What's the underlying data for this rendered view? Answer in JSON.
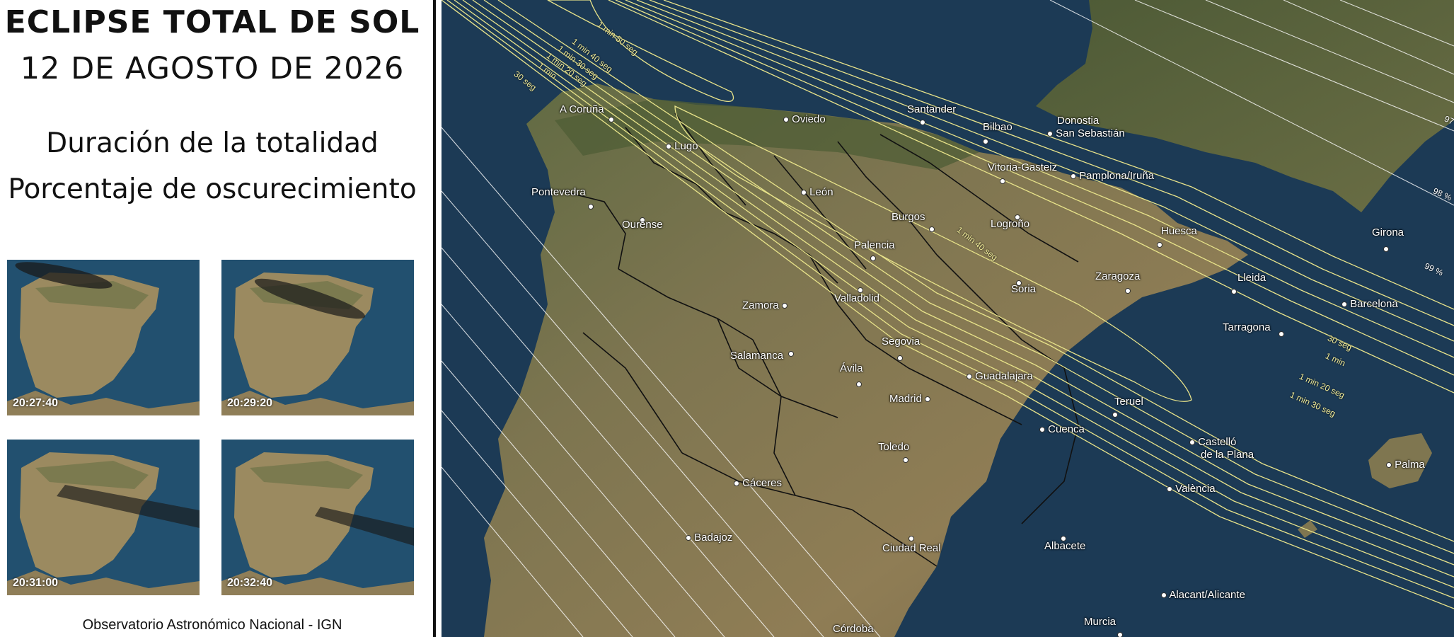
{
  "panel": {
    "title_main": "ECLIPSE TOTAL DE SOL",
    "title_date": "12 DE AGOSTO DE 2026",
    "subtitle_1": "Duración de la totalidad",
    "subtitle_2": "Porcentaje de oscurecimiento",
    "footer": "Observatorio Astronómico Nacional - IGN"
  },
  "thumbnails": [
    {
      "time": "20:27:40"
    },
    {
      "time": "20:29:20"
    },
    {
      "time": "20:31:00"
    },
    {
      "time": "20:32:40"
    }
  ],
  "map": {
    "duration_labels": {
      "d150": "1 min 50 seg",
      "d140": "1 min 40 seg",
      "d130": "1 min 30 seg",
      "d120": "1 min 20 seg",
      "d1": "1 min",
      "d30": "30 seg",
      "inner140": "1 min 40 seg",
      "r30": "30 seg",
      "r1": "1 min",
      "r120": "1 min 20 seg",
      "r130": "1 min 30 seg"
    },
    "percent_labels": {
      "p97": "97",
      "p98": "98 %",
      "p99": "99 %"
    },
    "cities": {
      "a_coruna": "A Coruña",
      "lugo": "Lugo",
      "oviedo": "Oviedo",
      "santander": "Santander",
      "bilbao": "Bilbao",
      "donostia": "Donostia",
      "san_sebastian": "San Sebastián",
      "vitoria": "Vitoria-Gasteiz",
      "pamplona": "Pamplona/Iruña",
      "pontevedra": "Pontevedra",
      "ourense": "Ourense",
      "leon": "León",
      "burgos": "Burgos",
      "logrono": "Logroño",
      "palencia": "Palencia",
      "huesca": "Huesca",
      "girona": "Girona",
      "soria": "Soria",
      "zaragoza": "Zaragoza",
      "lleida": "Lleida",
      "zamora": "Zamora",
      "valladolid": "Valladolid",
      "barcelona": "Barcelona",
      "tarragona": "Tarragona",
      "salamanca": "Salamanca",
      "segovia": "Segovia",
      "avila": "Ávila",
      "guadalajara": "Guadalajara",
      "madrid": "Madrid",
      "teruel": "Teruel",
      "cuenca": "Cuenca",
      "castello": "Castelló",
      "castello2": "de la Plana",
      "toledo": "Toledo",
      "caceres": "Cáceres",
      "valencia": "València",
      "palma": "Palma",
      "badajoz": "Badajoz",
      "ciudad_real": "Ciudad Real",
      "albacete": "Albacete",
      "alicante": "Alacant/Alicante",
      "murcia": "Murcia",
      "cordoba": "Córdoba"
    }
  },
  "colors": {
    "land": "#8a7a55",
    "sea": "#1c3a55",
    "duration_line": "#e8e38a",
    "percent_line": "#ffffff",
    "border": "#111111"
  }
}
